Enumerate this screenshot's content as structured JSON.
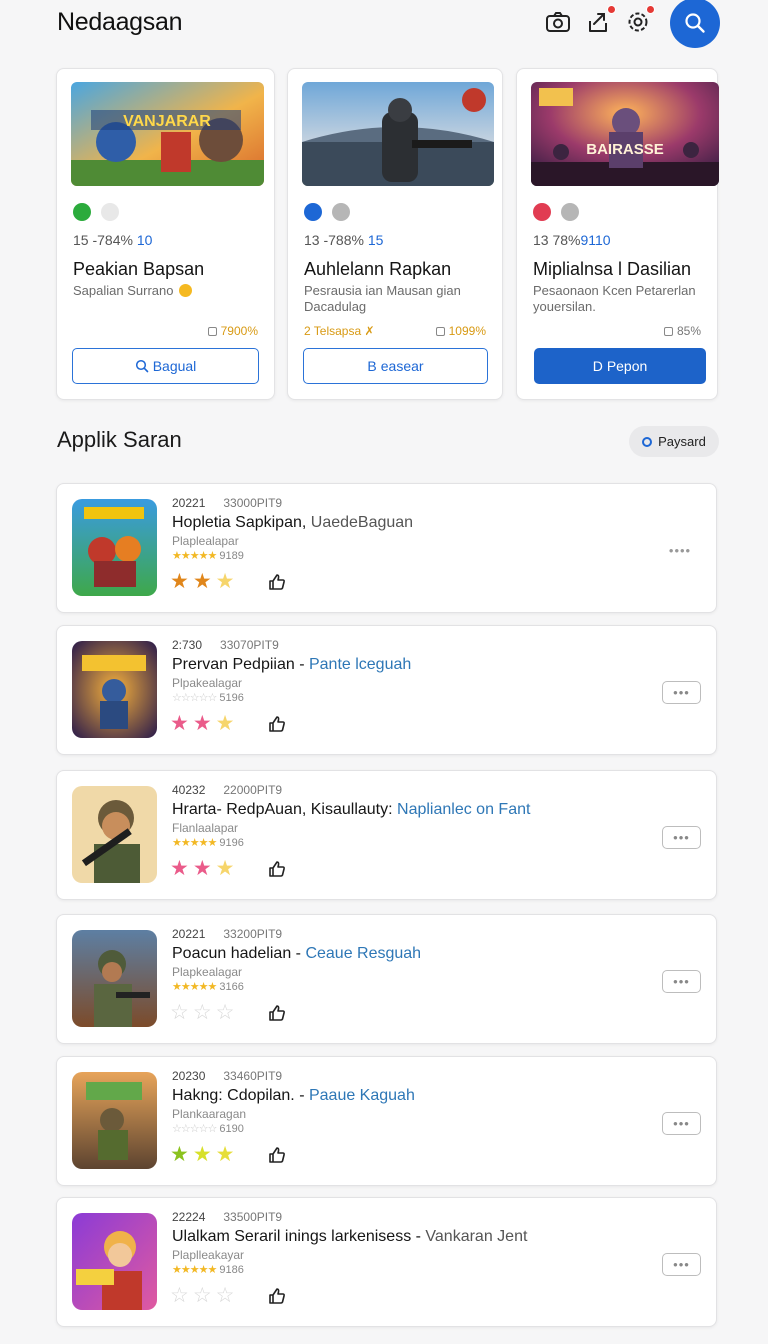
{
  "header": {
    "title": "Nedaagsan",
    "icons": [
      "camera-icon",
      "share-icon",
      "settings-icon",
      "search-icon"
    ]
  },
  "featured": [
    {
      "image": "Vanjarar game art",
      "image_text": "VANJARAR",
      "dots": [
        "#2bab3c",
        "#e8e8e8"
      ],
      "meta_a": "15 -784%",
      "meta_b": "10",
      "title": "Peakian Bapsan",
      "subtitle": "Sapalian Surrano",
      "tag": "",
      "percent": "7900%",
      "button": "Bagual",
      "button_icon": "search-icon",
      "button_style": "outline"
    },
    {
      "image": "Soldier stadium art",
      "image_text": "",
      "dots": [
        "#1d67d5",
        "#b6b6b6"
      ],
      "meta_a": "13 -788%",
      "meta_b": "15",
      "title": "Auhlelann Rapkan",
      "subtitle": "Pesrausia ian Mausan gian Dacadulag",
      "tag": "2  Telsapsa ✗",
      "percent": "1099%",
      "button": "easear",
      "button_icon": "B",
      "button_style": "outline"
    },
    {
      "image": "Concert game art",
      "image_text": "BAIRASSE",
      "dots": [
        "#e13c52",
        "#b6b6b6"
      ],
      "meta_a": "13  78%",
      "meta_b": "9110",
      "title": "Miplialnsa l Dasilian",
      "subtitle": "Pesaonaon Kcen Petarerlan youersilan.",
      "tag": "",
      "percent": "85%",
      "button": "Pepon",
      "button_icon": "D",
      "button_style": "primary"
    }
  ],
  "section": {
    "title": "Applik Saran",
    "filter": "Paysard"
  },
  "apps": [
    {
      "icon": "brawl-heroes-icon",
      "year": "20221",
      "code": "33000PIT9",
      "title_a": "Hopletia Sapkipan,",
      "title_b": "UaedeBaguan",
      "title_b_style": "grey",
      "developer": "Plaplealapar",
      "mini_stars": "★★★★★",
      "rating_count": "9189",
      "stars": [
        "#e0861b",
        "#e0861b",
        "#f6d56b"
      ],
      "more": "••••",
      "more_style": "plain"
    },
    {
      "icon": "witchers-icon",
      "year": "2:730",
      "code": "33070PIT9",
      "title_a": "Prervan Pedpiian -",
      "title_b": "Pante lceguah",
      "title_b_style": "accent",
      "developer": "Plpakealagar",
      "mini_stars": "☆☆☆☆☆",
      "rating_count": "5196",
      "stars": [
        "#ea5b8a",
        "#ea5b8a",
        "#f6d56b"
      ],
      "more": "•••",
      "more_style": "box"
    },
    {
      "icon": "commando-icon",
      "year": "40232",
      "code": "22000PIT9",
      "title_a": "Hrarta- RedpAuan, Kisaullauty:",
      "title_b": "Naplianlec on Fant",
      "title_b_style": "accent",
      "developer": "Flanlaalapar",
      "mini_stars": "★★★★★",
      "rating_count": "9196",
      "stars": [
        "#ea5b8a",
        "#ea5b8a",
        "#f6d56b"
      ],
      "more": "•••",
      "more_style": "box"
    },
    {
      "icon": "soldier-icon",
      "year": "20221",
      "code": "33200PIT9",
      "title_a": "Poacun hadelian -",
      "title_b": "Ceaue Resguah",
      "title_b_style": "accent",
      "developer": "Plapkealagar",
      "mini_stars": "★★★★★",
      "rating_count": "3166",
      "stars": [
        "#d7d7d7",
        "#d7d7d7",
        "#d7d7d7"
      ],
      "more": "•••",
      "more_style": "box"
    },
    {
      "icon": "war-heroes-icon",
      "year": "20230",
      "code": "33460PIT9",
      "title_a": "Hakng: Cdopilan. -",
      "title_b": "Paaue Kaguah",
      "title_b_style": "accent",
      "developer": "Plankaaragan",
      "mini_stars": "☆☆☆☆☆",
      "rating_count": "6190",
      "stars": [
        "#8bc21e",
        "#d7e02a",
        "#e6de3a"
      ],
      "more": "•••",
      "more_style": "box"
    },
    {
      "icon": "evils-icon",
      "year": "22224",
      "code": "33500PIT9",
      "title_a": "Ulalkam Seraril inings larkenisess -",
      "title_b": "Vankaran Jent",
      "title_b_style": "grey",
      "developer": "Plaplleakayar",
      "mini_stars": "★★★★★",
      "rating_count": "9186",
      "stars": [
        "#d7d7d7",
        "#d7d7d7",
        "#d7d7d7"
      ],
      "more": "•••",
      "more_style": "box"
    }
  ]
}
